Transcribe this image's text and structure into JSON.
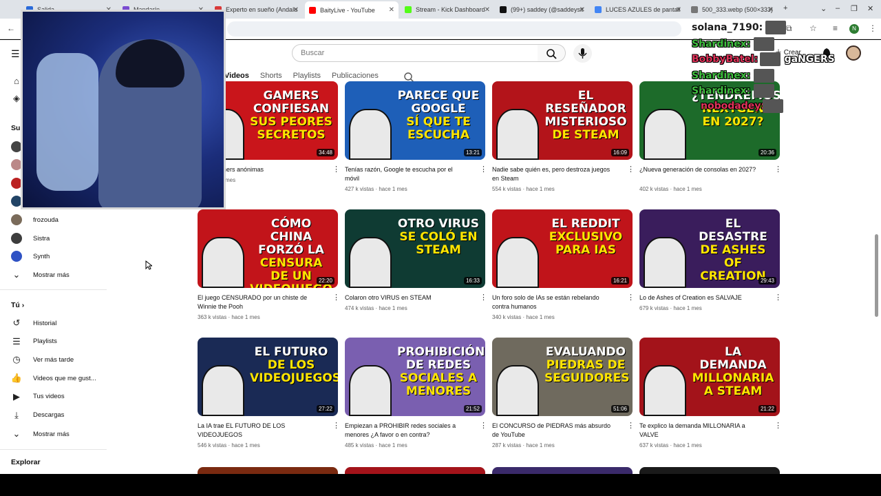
{
  "browser": {
    "tabs": [
      {
        "label": "Salida...",
        "color": "#2a6ad9"
      },
      {
        "label": "Mandarín ...",
        "color": "#7a4bd1"
      },
      {
        "label": "Experto en sueño (Andalu",
        "color": "#d93a3a"
      },
      {
        "label": "BaityLive - YouTube",
        "color": "#ff0000"
      },
      {
        "label": "Stream - Kick Dashboard",
        "color": "#53fc18"
      },
      {
        "label": "(99+) saddey (@saddeysit",
        "color": "#111111"
      },
      {
        "label": "LUCES AZULES de pantall",
        "color": "#4285f4"
      },
      {
        "label": "500_333.webp (500×333)",
        "color": "#777777"
      }
    ],
    "active_tab_index": 3,
    "new_tab": "+",
    "window_controls": [
      "⌄",
      "–",
      "❐",
      "✕"
    ],
    "profile_initial": "N"
  },
  "youtube": {
    "search_placeholder": "Buscar",
    "create_label": "Crear",
    "channel_tabs": [
      "Videos",
      "Shorts",
      "Playlists",
      "Publicaciones"
    ],
    "active_channel_tab": "Videos"
  },
  "sidebar": {
    "subscriptions_heading": "Su",
    "channels": [
      {
        "name": "frozouda",
        "color": "#7a6b5a"
      },
      {
        "name": "Sistra",
        "color": "#3d3d3d"
      },
      {
        "name": "Synth",
        "color": "#2f52c4"
      }
    ],
    "show_more_1": "Mostrar más",
    "you_heading": "Tú",
    "you_items": [
      {
        "label": "Historial",
        "icon": "history-icon"
      },
      {
        "label": "Playlists",
        "icon": "playlists-icon"
      },
      {
        "label": "Ver más tarde",
        "icon": "watch-later-icon"
      },
      {
        "label": "Videos que me gust...",
        "icon": "liked-videos-icon"
      },
      {
        "label": "Tus videos",
        "icon": "your-videos-icon"
      },
      {
        "label": "Descargas",
        "icon": "downloads-icon"
      }
    ],
    "show_more_2": "Mostrar más",
    "explore_heading": "Explorar"
  },
  "videos": [
    {
      "thumb_text": "Gamers confiesan",
      "thumb_accent": "sus peores secretos",
      "bg": "#c9151b",
      "duration": "34:48",
      "title": "...hes gamers anónimas",
      "meta": "... · hace 1 mes"
    },
    {
      "thumb_text": "Parece que Google",
      "thumb_accent": "sí que te escucha",
      "bg": "#1e5fb8",
      "duration": "13:21",
      "title": "Tenías razón, Google te escucha por el móvil",
      "meta": "427 k vistas · hace 1 mes"
    },
    {
      "thumb_text": "El reseñador misterioso",
      "thumb_accent": "de Steam",
      "bg": "#b3141a",
      "duration": "16:09",
      "title": "Nadie sabe quién es, pero destroza juegos en Steam",
      "meta": "554 k vistas · hace 1 mes"
    },
    {
      "thumb_text": "¿Tendremos",
      "thumb_accent": "nextgen en 2027?",
      "bg": "#1d6b2a",
      "duration": "20:36",
      "title": "¿Nueva generación de consolas en 2027?",
      "meta": "402 k vistas · hace 1 mes"
    },
    {
      "thumb_text": "Cómo China forzó la",
      "thumb_accent": "censura de un videojuego",
      "bg": "#c2141a",
      "duration": "22:20",
      "title": "El juego CENSURADO por un chiste de Winnie the Pooh",
      "meta": "363 k vistas · hace 1 mes"
    },
    {
      "thumb_text": "Otro virus",
      "thumb_accent": "se coló en Steam",
      "bg": "#0f3b33",
      "duration": "16:33",
      "title": "Colaron otro VIRUS en STEAM",
      "meta": "474 k vistas · hace 1 mes"
    },
    {
      "thumb_text": "El Reddit",
      "thumb_accent": "exclusivo para IAs",
      "bg": "#c0141a",
      "duration": "16:21",
      "title": "Un foro solo de IAs se están rebelando contra humanos",
      "meta": "340 k vistas · hace 1 mes"
    },
    {
      "thumb_text": "El desastre",
      "thumb_accent": "de Ashes of Creation",
      "bg": "#3a1d5c",
      "duration": "29:43",
      "title": "Lo de Ashes of Creation es SALVAJE",
      "meta": "679 k vistas · hace 1 mes"
    },
    {
      "thumb_text": "El futuro",
      "thumb_accent": "de los videojuegos",
      "bg": "#1a2a55",
      "duration": "27:22",
      "title": "La IA trae EL FUTURO DE LOS VIDEOJUEGOS",
      "meta": "546 k vistas · hace 1 mes"
    },
    {
      "thumb_text": "Prohibición de redes",
      "thumb_accent": "sociales a menores",
      "bg": "#7a5fb0",
      "duration": "21:52",
      "title": "Empiezan a PROHIBIR redes sociales a menores ¿A favor o en contra?",
      "meta": "485 k vistas · hace 1 mes"
    },
    {
      "thumb_text": "Evaluando",
      "thumb_accent": "piedras de seguidores",
      "bg": "#6f6a5e",
      "duration": "51:06",
      "title": "El CONCURSO de PIEDRAS más absurdo de YouTube",
      "meta": "287 k vistas · hace 1 mes"
    },
    {
      "thumb_text": "La demanda",
      "thumb_accent": "millonaria a Steam",
      "bg": "#a3131a",
      "duration": "21:22",
      "title": "Te explico la demanda MILLONARIA a VALVE",
      "meta": "637 k vistas · hace 1 mes"
    }
  ],
  "chat": [
    {
      "user": "solana_7190:",
      "color": "#1a1a1a"
    },
    {
      "user": "Shardinex:",
      "color": "#3fbf3f"
    },
    {
      "user": "BobbyBatel:",
      "color": "#e0335a",
      "text": "gaNGERS"
    },
    {
      "user": "Shardinex:",
      "color": "#3fbf3f"
    },
    {
      "user": "Shardinex:",
      "color": "#3fbf3f"
    },
    {
      "user": "nobodadey:",
      "color": "#e0335a"
    }
  ]
}
